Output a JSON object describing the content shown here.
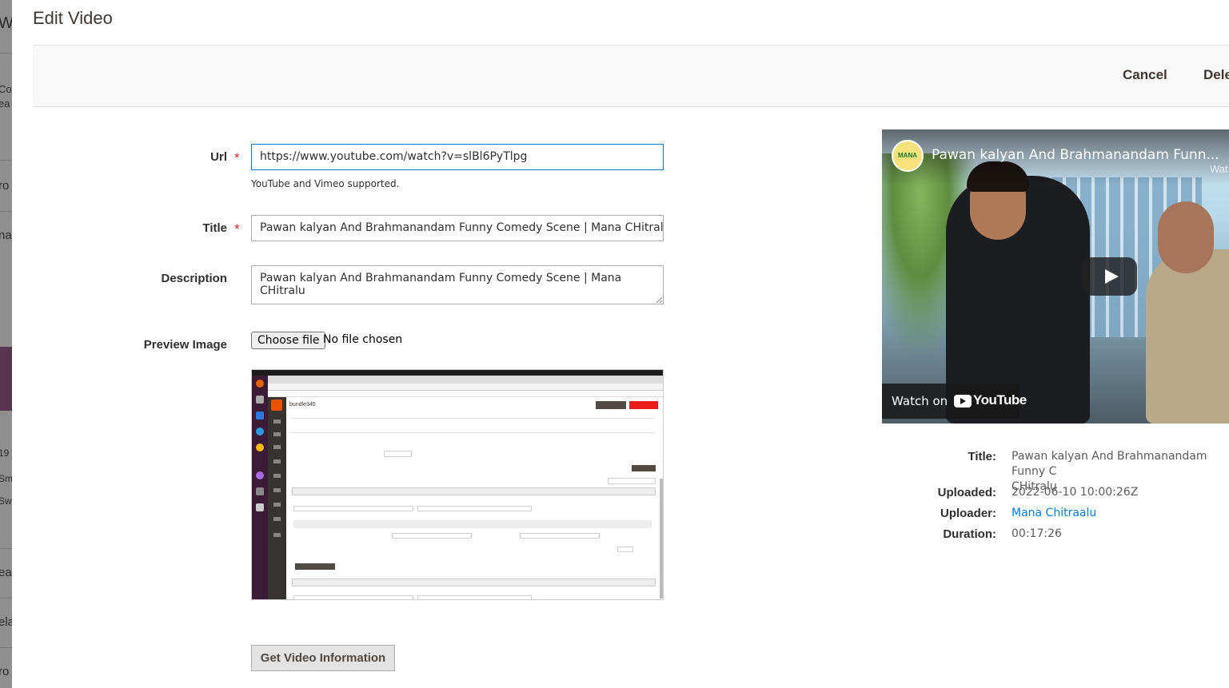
{
  "background": {
    "fragments": [
      "W",
      "Co",
      "ea",
      "ro",
      "na",
      "19",
      "Sm",
      "Sw",
      "ea",
      "ela",
      "ro"
    ]
  },
  "modal": {
    "title": "Edit Video",
    "toolbar": {
      "cancel_label": "Cancel",
      "delete_label": "Dele"
    }
  },
  "form": {
    "url": {
      "label": "Url",
      "value": "https://www.youtube.com/watch?v=slBl6PyTlpg",
      "note": "YouTube and Vimeo supported."
    },
    "title": {
      "label": "Title",
      "value": "Pawan kalyan And Brahmanandam Funny Comedy Scene | Mana CHitralu"
    },
    "description": {
      "label": "Description",
      "value": "Pawan kalyan And Brahmanandam Funny Comedy Scene | Mana CHitralu"
    },
    "preview_image": {
      "label": "Preview Image",
      "choose_label": "Choose file",
      "status": "No file chosen",
      "thumb_title": "bundle345"
    },
    "get_info_label": "Get Video Information"
  },
  "player": {
    "title": "Pawan kalyan And Brahmanandam Funn...",
    "watch_later": "Wat",
    "channel_badge": "MANA",
    "watch_on": "Watch on",
    "youtube": "YouTube"
  },
  "info": {
    "title_label": "Title:",
    "title_value_line1": "Pawan kalyan And Brahmanandam Funny C",
    "title_value_line2": "CHitralu",
    "uploaded_label": "Uploaded:",
    "uploaded_value": "2022-06-10 10:00:26Z",
    "uploader_label": "Uploader:",
    "uploader_value": "Mana Chitraalu",
    "duration_label": "Duration:",
    "duration_value": "00:17:26"
  },
  "colors": {
    "accent": "#007bdb",
    "required": "#e22626",
    "text": "#303030"
  }
}
